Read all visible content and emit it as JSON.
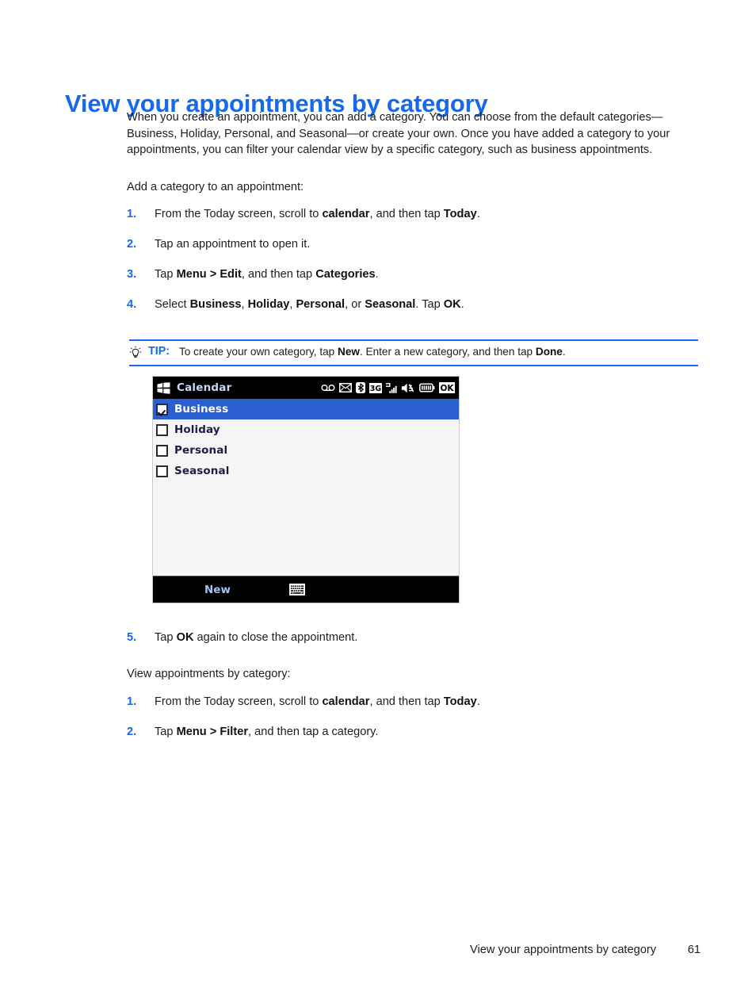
{
  "colors": {
    "accent_blue": "#1668ee",
    "selection_blue": "#2b5fd0",
    "device_bar_black": "#000000",
    "device_list_bg": "#f5f5f5",
    "title_text_blue": "#c8d8f0",
    "soft_key_blue": "#9dc6f2"
  },
  "heading": "View your appointments by category",
  "intro_paragraph": "When you create an appointment, you can add a category. You can choose from the default categories—Business, Holiday, Personal, and Seasonal—or create your own. Once you have added a category to your appointments, you can filter your calendar view by a specific category, such as business appointments.",
  "section_one": {
    "lead": "Add a category to an appointment:",
    "steps": [
      {
        "num": "1.",
        "parts": [
          {
            "t": "From the Today screen, scroll to ",
            "b": false
          },
          {
            "t": "calendar",
            "b": true
          },
          {
            "t": ", and then tap ",
            "b": false
          },
          {
            "t": "Today",
            "b": true
          },
          {
            "t": ".",
            "b": false
          }
        ]
      },
      {
        "num": "2.",
        "parts": [
          {
            "t": "Tap an appointment to open it.",
            "b": false
          }
        ]
      },
      {
        "num": "3.",
        "parts": [
          {
            "t": "Tap ",
            "b": false
          },
          {
            "t": "Menu > Edit",
            "b": true
          },
          {
            "t": ", and then tap ",
            "b": false
          },
          {
            "t": "Categories",
            "b": true
          },
          {
            "t": ".",
            "b": false
          }
        ]
      },
      {
        "num": "4.",
        "parts": [
          {
            "t": "Select ",
            "b": false
          },
          {
            "t": "Business",
            "b": true
          },
          {
            "t": ", ",
            "b": false
          },
          {
            "t": "Holiday",
            "b": true
          },
          {
            "t": ", ",
            "b": false
          },
          {
            "t": "Personal",
            "b": true
          },
          {
            "t": ", or ",
            "b": false
          },
          {
            "t": "Seasonal",
            "b": true
          },
          {
            "t": ". Tap ",
            "b": false
          },
          {
            "t": "OK",
            "b": true
          },
          {
            "t": ".",
            "b": false
          }
        ]
      }
    ]
  },
  "tip": {
    "icon": "lightbulb-icon",
    "label": "TIP:",
    "parts": [
      {
        "t": "To create your own category, tap ",
        "b": false
      },
      {
        "t": "New",
        "b": true
      },
      {
        "t": ". Enter a new category, and then tap ",
        "b": false
      },
      {
        "t": "Done",
        "b": true
      },
      {
        "t": ".",
        "b": false
      }
    ]
  },
  "device": {
    "title": "Calendar",
    "logo_icon": "windows-logo-icon",
    "status_icons": [
      "voicemail-icon",
      "envelope-icon",
      "bluetooth-icon",
      "3g-icon",
      "signal-bars-icon",
      "speaker-icon",
      "battery-icon",
      "ok-button-icon"
    ],
    "list": [
      {
        "label": "Business",
        "checked": true,
        "selected": true
      },
      {
        "label": "Holiday",
        "checked": false,
        "selected": false
      },
      {
        "label": "Personal",
        "checked": false,
        "selected": false
      },
      {
        "label": "Seasonal",
        "checked": false,
        "selected": false
      }
    ],
    "softkey_left": "New",
    "softkey_keyboard_icon": "keyboard-icon"
  },
  "step_five": {
    "num": "5.",
    "parts": [
      {
        "t": "Tap ",
        "b": false
      },
      {
        "t": "OK",
        "b": true
      },
      {
        "t": " again to close the appointment.",
        "b": false
      }
    ]
  },
  "section_two": {
    "lead": "View appointments by category:",
    "steps": [
      {
        "num": "1.",
        "parts": [
          {
            "t": "From the Today screen, scroll to ",
            "b": false
          },
          {
            "t": "calendar",
            "b": true
          },
          {
            "t": ", and then tap ",
            "b": false
          },
          {
            "t": "Today",
            "b": true
          },
          {
            "t": ".",
            "b": false
          }
        ]
      },
      {
        "num": "2.",
        "parts": [
          {
            "t": "Tap ",
            "b": false
          },
          {
            "t": "Menu > Filter",
            "b": true
          },
          {
            "t": ", and then tap a category.",
            "b": false
          }
        ]
      }
    ]
  },
  "footer": {
    "title": "View your appointments by category",
    "page": "61"
  }
}
